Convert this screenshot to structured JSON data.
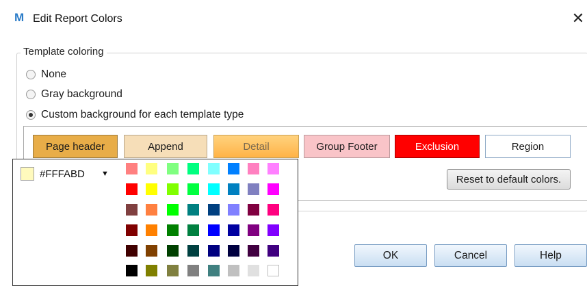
{
  "window": {
    "title": "Edit Report Colors",
    "logo": "M",
    "close_glyph": "✕"
  },
  "template_coloring": {
    "legend": "Template coloring",
    "options": [
      {
        "label": "None",
        "checked": false
      },
      {
        "label": "Gray background",
        "checked": false
      },
      {
        "label": "Custom background for each template type",
        "checked": true
      }
    ]
  },
  "template_types": [
    {
      "label": "Page header",
      "bg": "#E8AD48",
      "fg": "#1a1a1a",
      "border": "#9c7a3c"
    },
    {
      "label": "Append",
      "bg": "#F6DEB8",
      "fg": "#1a1a1a",
      "border": "#b7a58a"
    },
    {
      "label": "Detail",
      "bg": "#FFC060",
      "fg": "#7a6a50",
      "border": "#c9a054"
    },
    {
      "label": "Group Footer",
      "bg": "#F9C4C8",
      "fg": "#1a1a1a",
      "border": "#b9999c"
    },
    {
      "label": "Exclusion",
      "bg": "#FF0000",
      "fg": "#ffffff",
      "border": "#a00000"
    },
    {
      "label": "Region",
      "bg": "#FFFFFF",
      "fg": "#1a1a1a",
      "border": "#8aa6c4"
    }
  ],
  "reset_button": "Reset to default colors.",
  "dialog_buttons": {
    "ok": "OK",
    "cancel": "Cancel",
    "help": "Help"
  },
  "color_picker": {
    "current_value": "#FFFABD",
    "current_color": "#FFFABD",
    "palette": [
      [
        "#FF8080",
        "#FFFF80",
        "#80FF80",
        "#00FF80",
        "#80FFFF",
        "#0080FF",
        "#FF80C0",
        "#FF80FF"
      ],
      [
        "#FF0000",
        "#FFFF00",
        "#80FF00",
        "#00FF40",
        "#00FFFF",
        "#0080C0",
        "#8080C0",
        "#FF00FF"
      ],
      [
        "#804040",
        "#FF8040",
        "#00FF00",
        "#008080",
        "#004080",
        "#8080FF",
        "#800040",
        "#FF0080"
      ],
      [
        "#800000",
        "#FF8000",
        "#008000",
        "#008040",
        "#0000FF",
        "#0000A0",
        "#800080",
        "#8000FF"
      ],
      [
        "#400000",
        "#804000",
        "#004000",
        "#004040",
        "#000080",
        "#000040",
        "#400040",
        "#400080"
      ],
      [
        "#000000",
        "#808000",
        "#808040",
        "#808080",
        "#408080",
        "#C0C0C0",
        "#E0E0E0",
        "#FFFFFF"
      ]
    ]
  }
}
